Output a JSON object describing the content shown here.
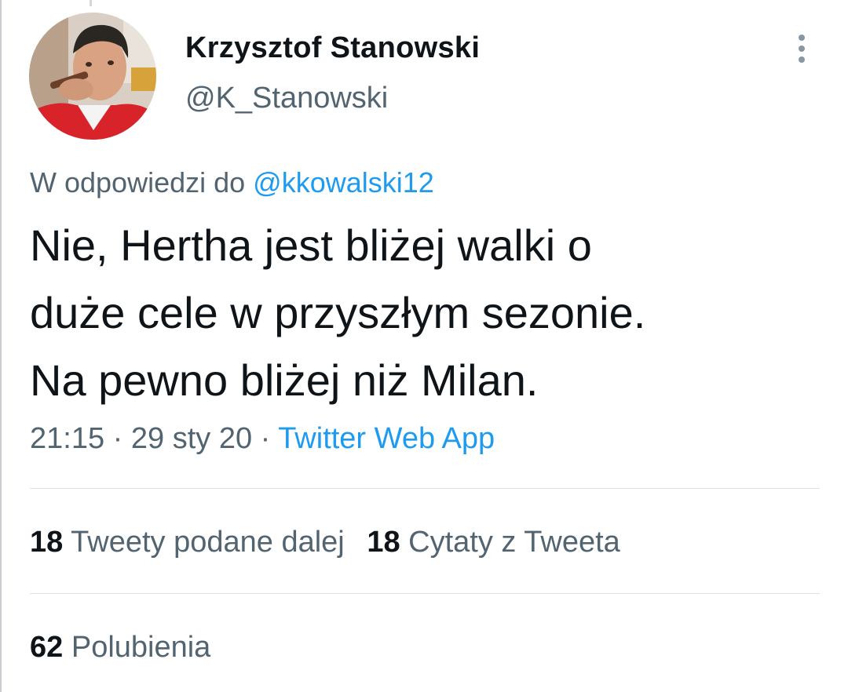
{
  "author": {
    "display_name": "Krzysztof Stanowski",
    "handle": "@K_Stanowski"
  },
  "reply": {
    "prefix": "W odpowiedzi do ",
    "mention": "@kkowalski12"
  },
  "tweet": {
    "lines": [
      "Nie, Hertha jest bliżej walki o",
      "duże cele w przyszłym sezonie.",
      "Na pewno bliżej niż Milan."
    ]
  },
  "meta": {
    "time": "21:15",
    "sep1": " · ",
    "date": "29 sty 20",
    "sep2": " · ",
    "source": "Twitter Web App"
  },
  "stats": {
    "retweets": {
      "count": "18",
      "label": "Tweety podane dalej"
    },
    "quotes": {
      "count": "18",
      "label": "Cytaty z Tweeta"
    },
    "likes": {
      "count": "62",
      "label": "Polubienia"
    }
  },
  "icons": {
    "more": "more-vertical-icon",
    "avatar": "profile-photo"
  },
  "colors": {
    "text": "#0f1419",
    "secondary": "#536471",
    "link": "#1d9bf0",
    "divider": "#dde1e5"
  }
}
